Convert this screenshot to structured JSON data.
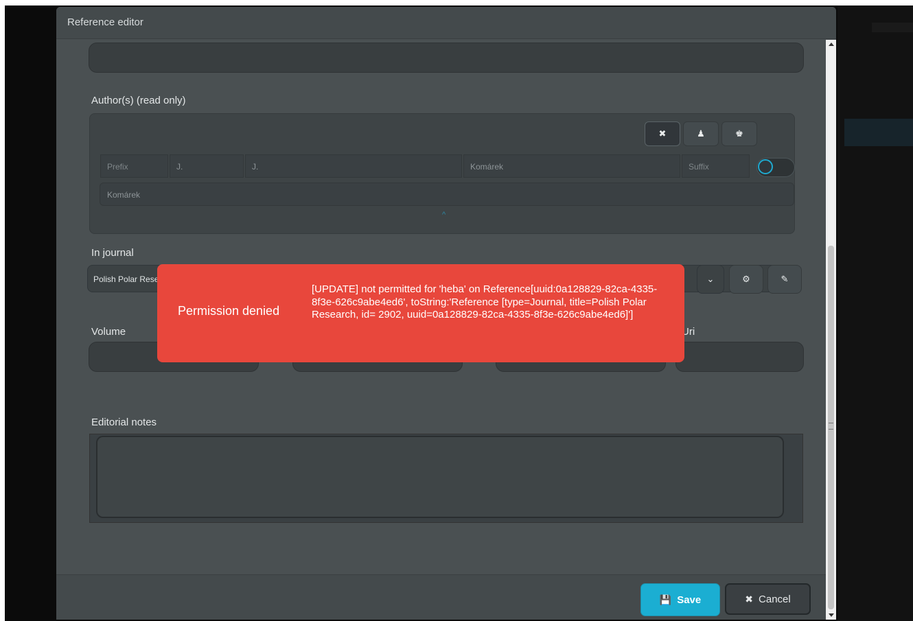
{
  "modal": {
    "title": "Reference editor"
  },
  "authors": {
    "label": "Author(s) (read only)",
    "buttons": [
      "✖",
      "♟",
      "♚"
    ],
    "row": {
      "prefix_placeholder": "Prefix",
      "initial1": "J.",
      "initial2": "J.",
      "surname": "Komárek",
      "suffix_placeholder": "Suffix"
    },
    "full_name": "Komárek",
    "collapse_glyph": "^"
  },
  "journal": {
    "label": "In journal",
    "value": "Polish Polar Research",
    "dropdown_glyph": "⌄",
    "settings_glyph": "⚙",
    "edit_glyph": "✎"
  },
  "fields": {
    "volume_label": "Volume",
    "uri_label": "Uri"
  },
  "notes": {
    "label": "Editorial notes"
  },
  "footer": {
    "save_label": "Save",
    "save_glyph": "💾",
    "cancel_label": "Cancel",
    "cancel_glyph": "✖"
  },
  "toast": {
    "title": "Permission denied",
    "message": "[UPDATE] not permitted for 'heba' on Reference[uuid:0a128829-82ca-4335-8f3e-626c9abe4ed6', toString:'Reference [type=Journal, title=Polish Polar Research, id= 2902, uuid=0a128829-82ca-4335-8f3e-626c9abe4ed6]']"
  },
  "colors": {
    "accent": "#1baed2",
    "error": "#e8473c",
    "panel": "#4a5052"
  }
}
